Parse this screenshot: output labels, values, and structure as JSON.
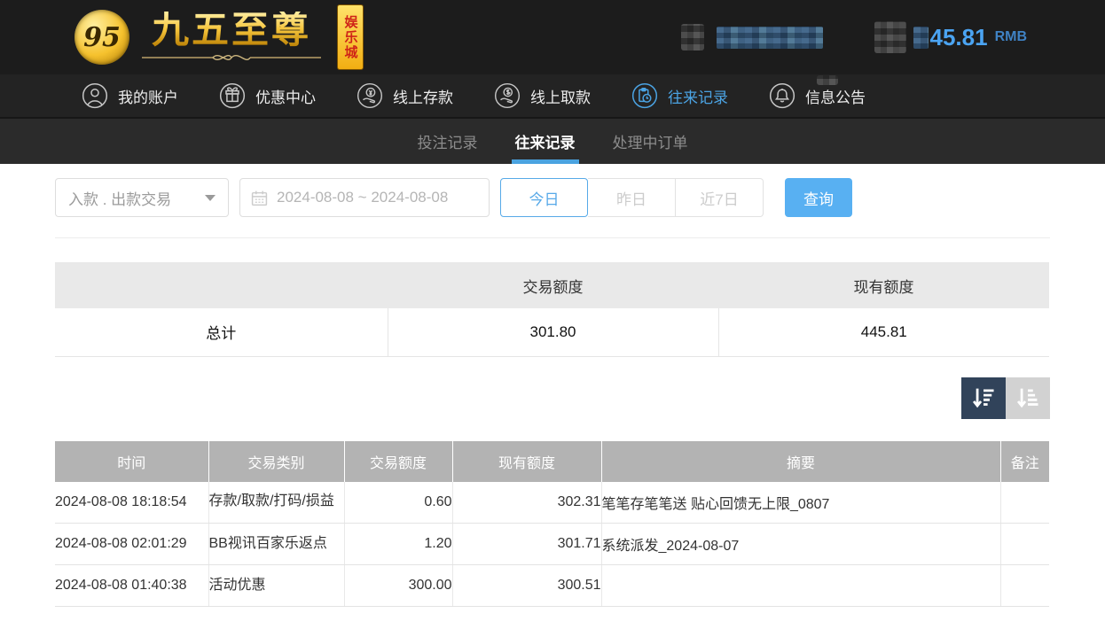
{
  "topbar": {
    "logo": {
      "symbol": "95",
      "wordmark": "九五至尊",
      "badge": "娱乐城"
    },
    "balance": {
      "amount": "45.81",
      "currency": "RMB"
    }
  },
  "nav": {
    "items": [
      {
        "label": "我的账户",
        "icon": "user-icon"
      },
      {
        "label": "优惠中心",
        "icon": "gift-icon"
      },
      {
        "label": "线上存款",
        "icon": "deposit-icon"
      },
      {
        "label": "线上取款",
        "icon": "withdraw-icon"
      },
      {
        "label": "往来记录",
        "icon": "records-icon",
        "active": true
      },
      {
        "label": "信息公告",
        "icon": "bell-icon"
      }
    ]
  },
  "subnav": {
    "tabs": [
      {
        "label": "投注记录"
      },
      {
        "label": "往来记录",
        "active": true
      },
      {
        "label": "处理中订单"
      }
    ]
  },
  "filters": {
    "type_select": "入款 . 出款交易",
    "date_range": "2024-08-08 ~ 2024-08-08",
    "quick": {
      "today": "今日",
      "yesterday": "昨日",
      "last7": "近7日"
    },
    "query": "查询"
  },
  "summary": {
    "col_amount": "交易额度",
    "col_balance": "现有额度",
    "total_label": "总计",
    "total_amount": "301.80",
    "total_balance": "445.81"
  },
  "table": {
    "columns": [
      "时间",
      "交易类别",
      "交易额度",
      "现有额度",
      "摘要",
      "备注"
    ],
    "rows": [
      {
        "time": "2024-08-08 18:18:54",
        "type": "存款/取款/打码/损益",
        "amount": "0.60",
        "balance": "302.31",
        "summary": "笔笔存笔笔送 贴心回馈无上限_0807",
        "note": ""
      },
      {
        "time": "2024-08-08 02:01:29",
        "type": "BB视讯百家乐返点",
        "amount": "1.20",
        "balance": "301.71",
        "summary": "系统派发_2024-08-07",
        "note": ""
      },
      {
        "time": "2024-08-08 01:40:38",
        "type": "活动优惠",
        "amount": "300.00",
        "balance": "300.51",
        "summary": "",
        "note": ""
      }
    ]
  },
  "colors": {
    "accent_blue": "#4aa3e0",
    "button_blue": "#58b0f2",
    "balance_blue": "#4ba4f2",
    "table_header_gray": "#b3b3b3",
    "sort_dark": "#31435a",
    "topbar_bg": "#1c1c1c",
    "gold": "#f6c53c"
  }
}
